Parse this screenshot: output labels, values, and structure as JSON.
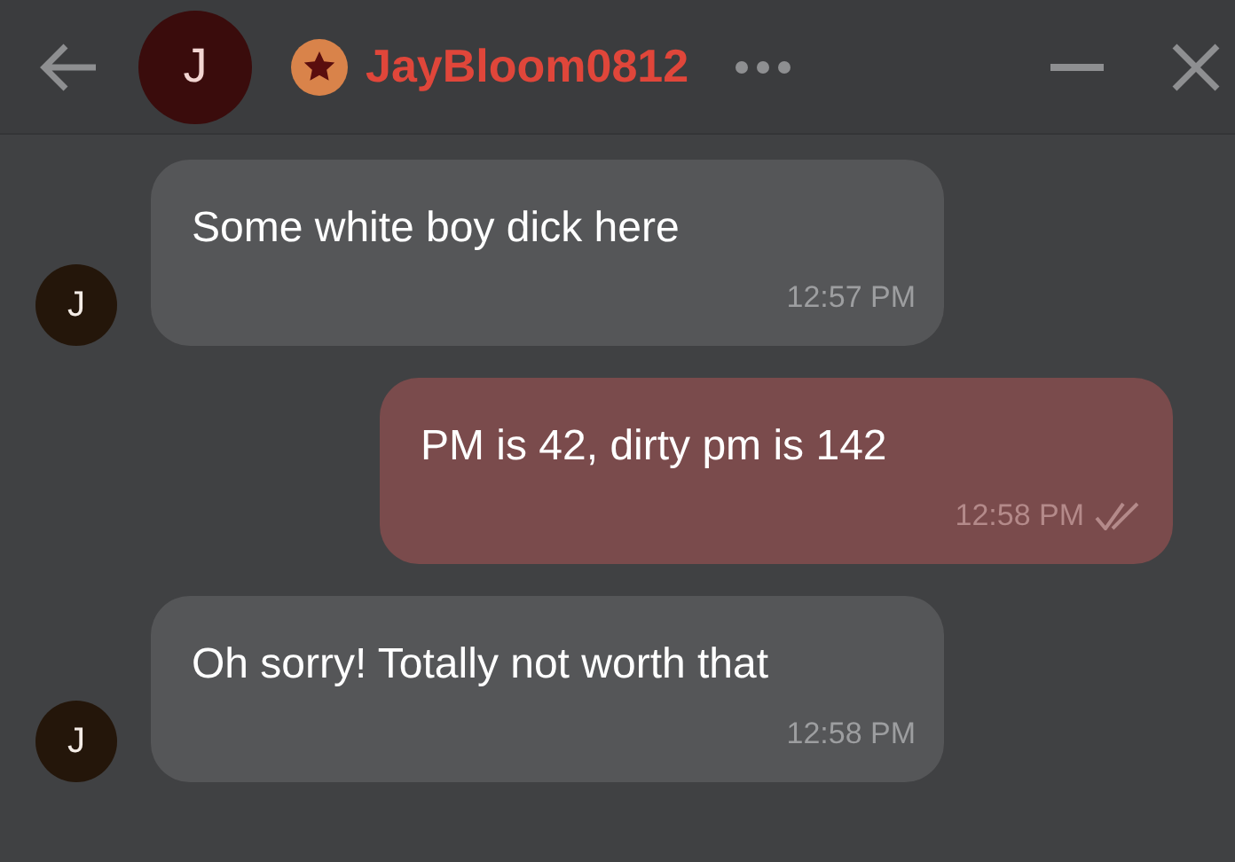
{
  "header": {
    "avatar_letter": "J",
    "username": "JayBloom0812"
  },
  "messages": [
    {
      "kind": "incoming",
      "avatar_letter": "J",
      "text": "Some white boy dick here",
      "time": "12:57 PM"
    },
    {
      "kind": "outgoing",
      "text": "PM is 42, dirty pm is 142",
      "time": "12:58 PM",
      "read": true
    },
    {
      "kind": "incoming",
      "avatar_letter": "J",
      "text": "Oh sorry! Totally not worth that",
      "time": "12:58 PM"
    }
  ]
}
